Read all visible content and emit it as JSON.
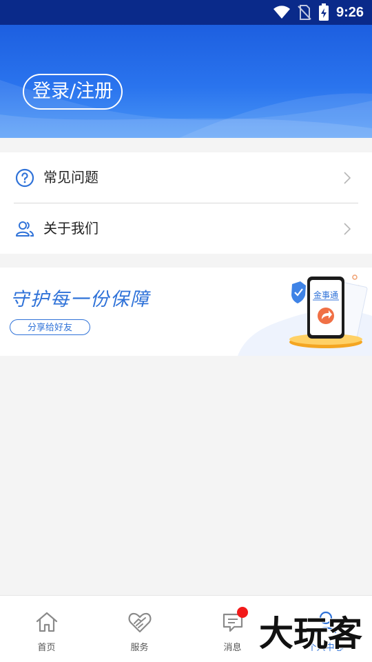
{
  "status_bar": {
    "time": "9:26"
  },
  "hero": {
    "login_label": "登录/注册"
  },
  "menu": {
    "items": [
      {
        "label": "常见问题",
        "icon": "question-circle-icon"
      },
      {
        "label": "关于我们",
        "icon": "users-icon"
      }
    ]
  },
  "banner": {
    "title": "守护每一份保障",
    "share_label": "分享给好友",
    "phone_brand": "金事通"
  },
  "tabbar": {
    "tabs": [
      {
        "label": "首页",
        "icon": "home-icon"
      },
      {
        "label": "服务",
        "icon": "handshake-heart-icon"
      },
      {
        "label": "消息",
        "icon": "message-icon"
      },
      {
        "label": "个人中心",
        "icon": "user-icon",
        "active": true
      }
    ]
  },
  "watermark": {
    "text": "大玩客"
  },
  "colors": {
    "primary": "#2a74ee",
    "status_bar": "#0a2a8a",
    "badge": "#f21a1a"
  }
}
